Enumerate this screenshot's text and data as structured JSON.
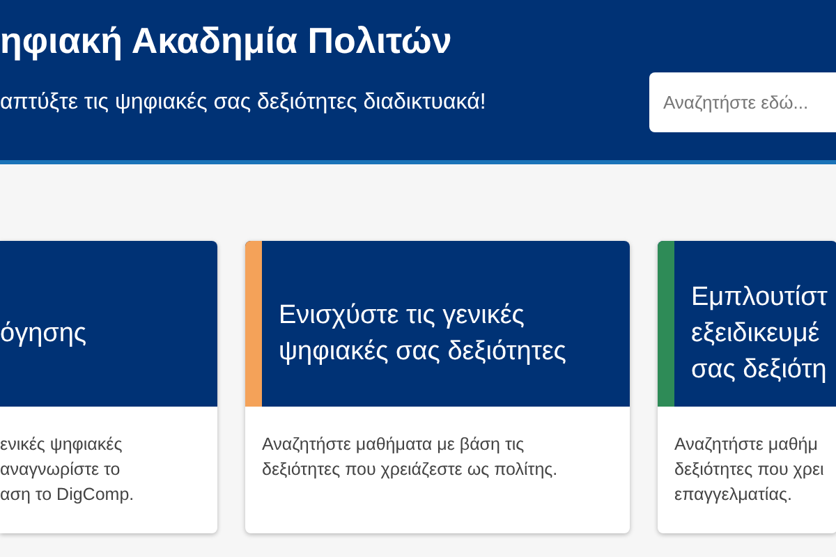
{
  "header": {
    "title": "ηφιακή Ακαδημία Πολιτών",
    "subtitle": "απτύξτε τις ψηφιακές σας δεξιότητες διαδικτυακά!",
    "search": {
      "placeholder": "Αναζητήστε εδώ..."
    }
  },
  "cards": [
    {
      "heading": [
        "όγησης"
      ],
      "body": [
        "ενικές ψηφιακές",
        "αναγνωρίστε το",
        "αση το DigComp."
      ]
    },
    {
      "color": "#f4a259",
      "heading": [
        "Ενισχύστε τις γενικές",
        "ψηφιακές σας δεξιότητες"
      ],
      "body": [
        "Αναζητήστε μαθήματα με βάση τις",
        "δεξιότητες που χρειάζεστε ως πολίτης."
      ]
    },
    {
      "color": "#2e8b57",
      "heading": [
        "Εμπλουτίστ",
        "εξειδικευμέ",
        "σας δεξιότη"
      ],
      "body": [
        "Αναζητήστε μαθήμ",
        "δεξιότητες που χρει",
        "επαγγελματίας."
      ]
    }
  ]
}
